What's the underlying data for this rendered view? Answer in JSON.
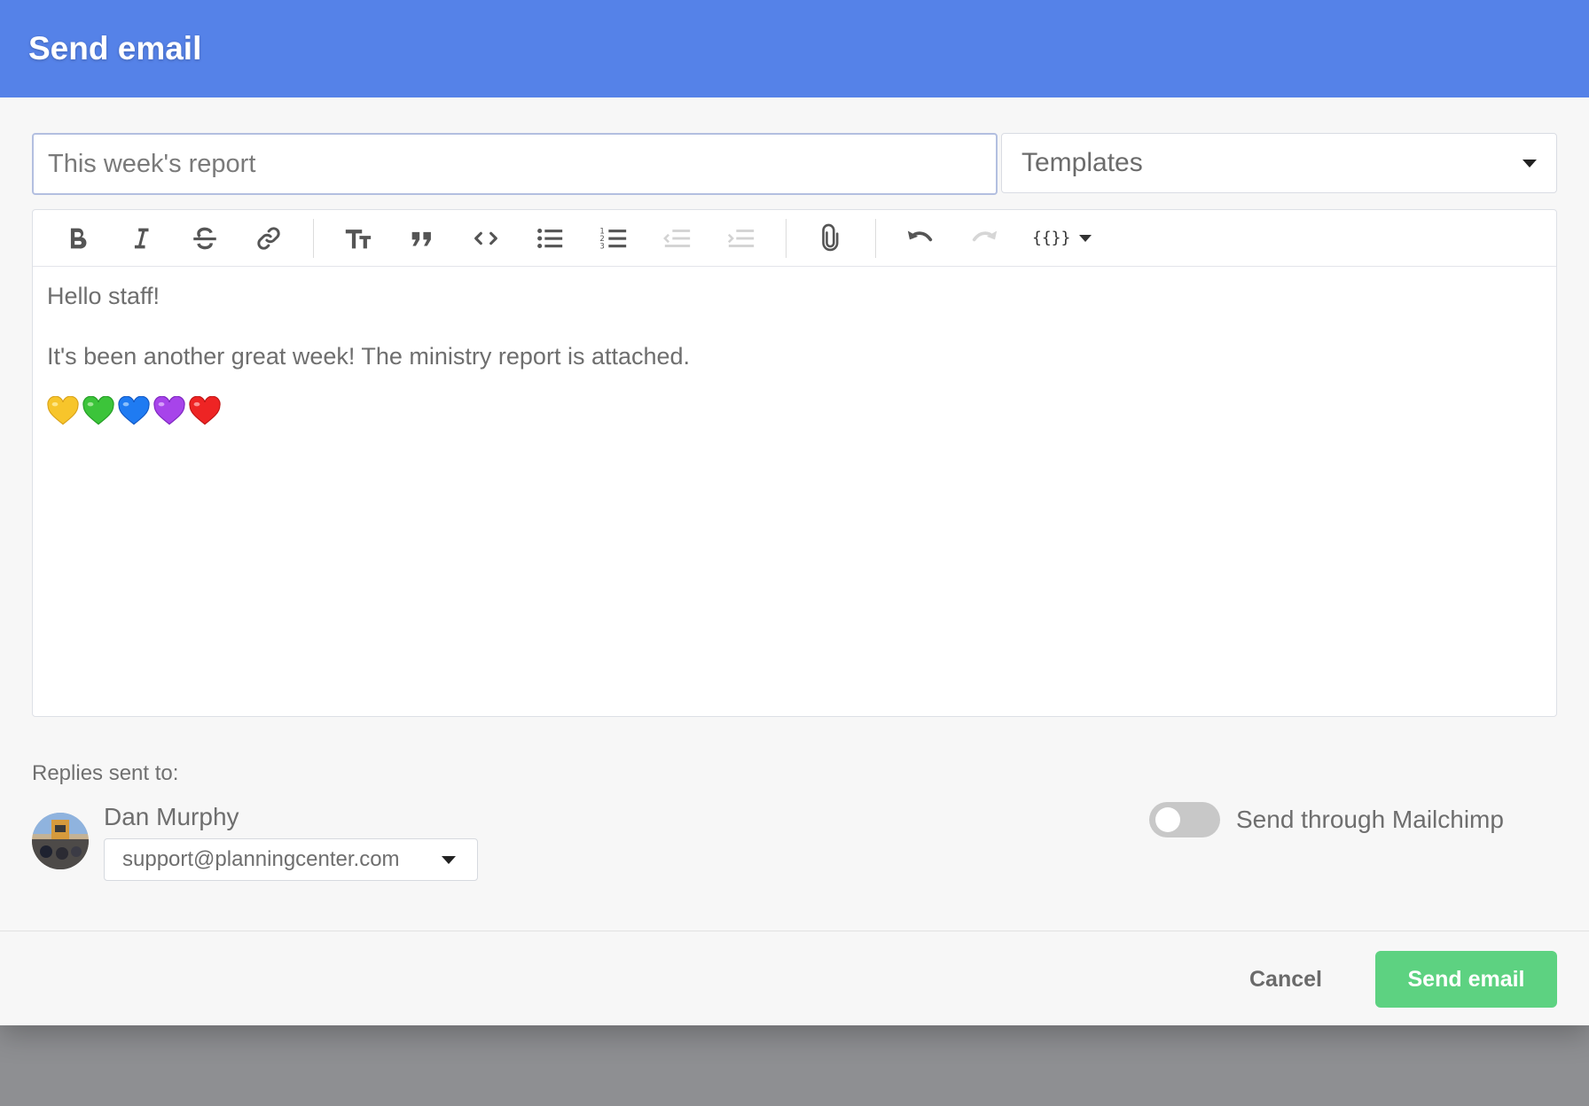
{
  "modal": {
    "title": "Send email"
  },
  "subject": {
    "placeholder": "This week's report",
    "value": ""
  },
  "templates": {
    "label": "Templates"
  },
  "toolbar": {
    "buttons": [
      "bold-icon",
      "italic-icon",
      "strikethrough-icon",
      "link-icon",
      "heading-icon",
      "quote-icon",
      "code-icon",
      "bullet-list-icon",
      "numbered-list-icon",
      "outdent-icon",
      "indent-icon",
      "attachment-icon",
      "undo-icon",
      "redo-icon"
    ],
    "variables_label": "{{}}"
  },
  "editor": {
    "line1": "Hello staff!",
    "line2": "It's been another great week! The ministry report is attached.",
    "emoji": [
      "yellow-heart",
      "green-heart",
      "blue-heart",
      "purple-heart",
      "red-heart"
    ]
  },
  "replies": {
    "label": "Replies sent to:",
    "sender_name": "Dan Murphy",
    "sender_email": "support@planningcenter.com"
  },
  "mailchimp": {
    "label": "Send through Mailchimp",
    "enabled": false
  },
  "footer": {
    "cancel_label": "Cancel",
    "send_label": "Send email"
  },
  "colors": {
    "header": "#5582e8",
    "send_button": "#5dd281",
    "toggle_off": "#c8c8c8"
  }
}
